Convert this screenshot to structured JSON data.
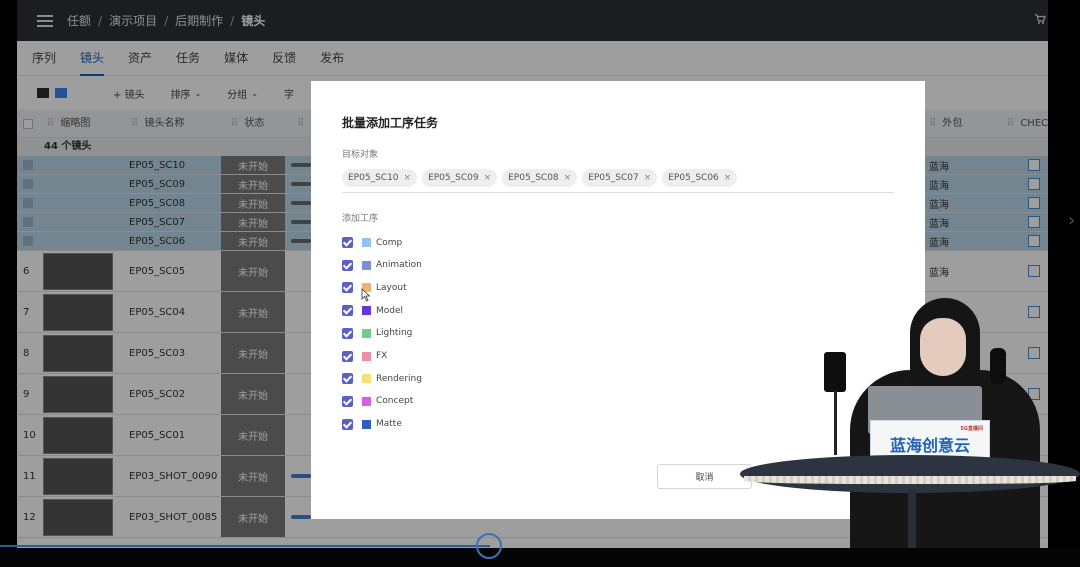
{
  "breadcrumb": [
    "任额",
    "演示项目",
    "后期制作",
    "镜头"
  ],
  "tabs": [
    {
      "label": "序列",
      "active": false
    },
    {
      "label": "镜头",
      "active": true
    },
    {
      "label": "资产",
      "active": false
    },
    {
      "label": "任务",
      "active": false
    },
    {
      "label": "媒体",
      "active": false
    },
    {
      "label": "反馈",
      "active": false
    },
    {
      "label": "发布",
      "active": false
    }
  ],
  "toolbar": {
    "add_shot": "+ 镜头",
    "sort": "排序",
    "group": "分组",
    "more": "字"
  },
  "table": {
    "headers": {
      "thumbnail": "缩略图",
      "shot_name": "镜头名称",
      "status": "状态",
      "outsource": "外包",
      "check": "CHEC"
    },
    "group_label": "44 个镜头",
    "rows": [
      {
        "index": "",
        "name": "EP05_SC10",
        "status": "未开始",
        "selected": true,
        "outsource": "蓝海",
        "thumb": false,
        "bar": "gray"
      },
      {
        "index": "",
        "name": "EP05_SC09",
        "status": "未开始",
        "selected": true,
        "outsource": "蓝海",
        "thumb": false,
        "bar": "gray"
      },
      {
        "index": "",
        "name": "EP05_SC08",
        "status": "未开始",
        "selected": true,
        "outsource": "蓝海",
        "thumb": false,
        "bar": "gray"
      },
      {
        "index": "",
        "name": "EP05_SC07",
        "status": "未开始",
        "selected": true,
        "outsource": "蓝海",
        "thumb": false,
        "bar": "gray"
      },
      {
        "index": "",
        "name": "EP05_SC06",
        "status": "未开始",
        "selected": true,
        "outsource": "蓝海",
        "thumb": false,
        "bar": "gray"
      },
      {
        "index": "6",
        "name": "EP05_SC05",
        "status": "未开始",
        "selected": false,
        "outsource": "蓝海",
        "thumb": true,
        "bar": "none"
      },
      {
        "index": "7",
        "name": "EP05_SC04",
        "status": "未开始",
        "selected": false,
        "outsource": "",
        "thumb": true,
        "bar": "none"
      },
      {
        "index": "8",
        "name": "EP05_SC03",
        "status": "未开始",
        "selected": false,
        "outsource": "",
        "thumb": true,
        "bar": "none"
      },
      {
        "index": "9",
        "name": "EP05_SC02",
        "status": "未开始",
        "selected": false,
        "outsource": "",
        "thumb": true,
        "bar": "none"
      },
      {
        "index": "10",
        "name": "EP05_SC01",
        "status": "未开始",
        "selected": false,
        "outsource": "",
        "thumb": true,
        "bar": "none"
      },
      {
        "index": "11",
        "name": "EP03_SHOT_0090",
        "status": "未开始",
        "selected": false,
        "outsource": "",
        "thumb": true,
        "bar": "blue"
      },
      {
        "index": "12",
        "name": "EP03_SHOT_0085",
        "status": "未开始",
        "selected": false,
        "outsource": "",
        "thumb": true,
        "bar": "blue"
      }
    ]
  },
  "modal": {
    "title": "批量添加工序任务",
    "target_label": "目标对象",
    "targets": [
      "EP05_SC10",
      "EP05_SC09",
      "EP05_SC08",
      "EP05_SC07",
      "EP05_SC06"
    ],
    "process_label": "添加工序",
    "processes": [
      {
        "name": "Comp",
        "color": "#8fc4ee",
        "checked": true
      },
      {
        "name": "Animation",
        "color": "#7b8fd6",
        "checked": true
      },
      {
        "name": "Layout",
        "color": "#f0b07a",
        "checked": true
      },
      {
        "name": "Model",
        "color": "#6a35d6",
        "checked": true
      },
      {
        "name": "Lighting",
        "color": "#6ccf8a",
        "checked": true
      },
      {
        "name": "FX",
        "color": "#ee8fa6",
        "checked": true
      },
      {
        "name": "Rendering",
        "color": "#f6e07a",
        "checked": true
      },
      {
        "name": "Concept",
        "color": "#d65ee4",
        "checked": true
      },
      {
        "name": "Matte",
        "color": "#2e5fb8",
        "checked": true
      }
    ],
    "cancel": "取消"
  },
  "presenter": {
    "sign_text": "蓝海创意云",
    "sign_tag": "5G直播间"
  }
}
